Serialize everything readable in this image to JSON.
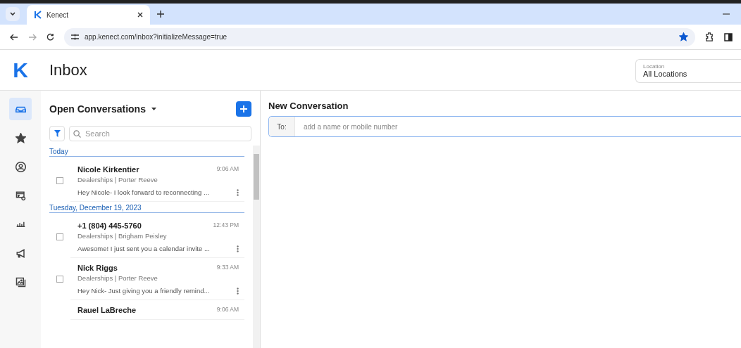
{
  "browser": {
    "tab": {
      "title": "Kenect"
    },
    "address": "app.kenect.com/inbox?initializeMessage=true",
    "bookmarked": true
  },
  "header": {
    "logo": "K",
    "title": "Inbox",
    "location": {
      "label": "Location",
      "value": "All Locations"
    }
  },
  "sidebar": {
    "items": [
      {
        "kind": "inbox",
        "selected": true
      },
      {
        "kind": "star",
        "selected": false
      },
      {
        "kind": "user",
        "selected": false
      },
      {
        "kind": "billing",
        "selected": false
      },
      {
        "kind": "chart",
        "selected": false
      },
      {
        "kind": "megaphone",
        "selected": false
      },
      {
        "kind": "image",
        "selected": false
      }
    ]
  },
  "list": {
    "title": "Open Conversations",
    "search": {
      "placeholder": "Search"
    },
    "groups": [
      {
        "heading": "Today",
        "rows": [
          {
            "name": "Nicole Kirkentier",
            "time": "9:06 AM",
            "subtitle": "Dealerships | Porter Reeve",
            "preview": "Hey Nicole- I look forward to reconnecting ...",
            "checked": false
          }
        ]
      },
      {
        "heading": "Tuesday, December 19, 2023",
        "rows": [
          {
            "name": "+1 (804) 445-5760",
            "time": "12:43 PM",
            "subtitle": "Dealerships | Brigham Peisley",
            "preview": "Awesome! I just sent you a calendar invite ...",
            "checked": false
          },
          {
            "name": "Nick Riggs",
            "time": "9:33 AM",
            "subtitle": "Dealerships | Porter Reeve",
            "preview": "Hey Nick- Just giving you a friendly remind...",
            "checked": false
          },
          {
            "name": "Rauel LaBreche",
            "time": "9:06 AM"
          }
        ]
      }
    ]
  },
  "compose": {
    "title": "New Conversation",
    "to_label": "To:",
    "placeholder": "add a name or mobile number"
  }
}
